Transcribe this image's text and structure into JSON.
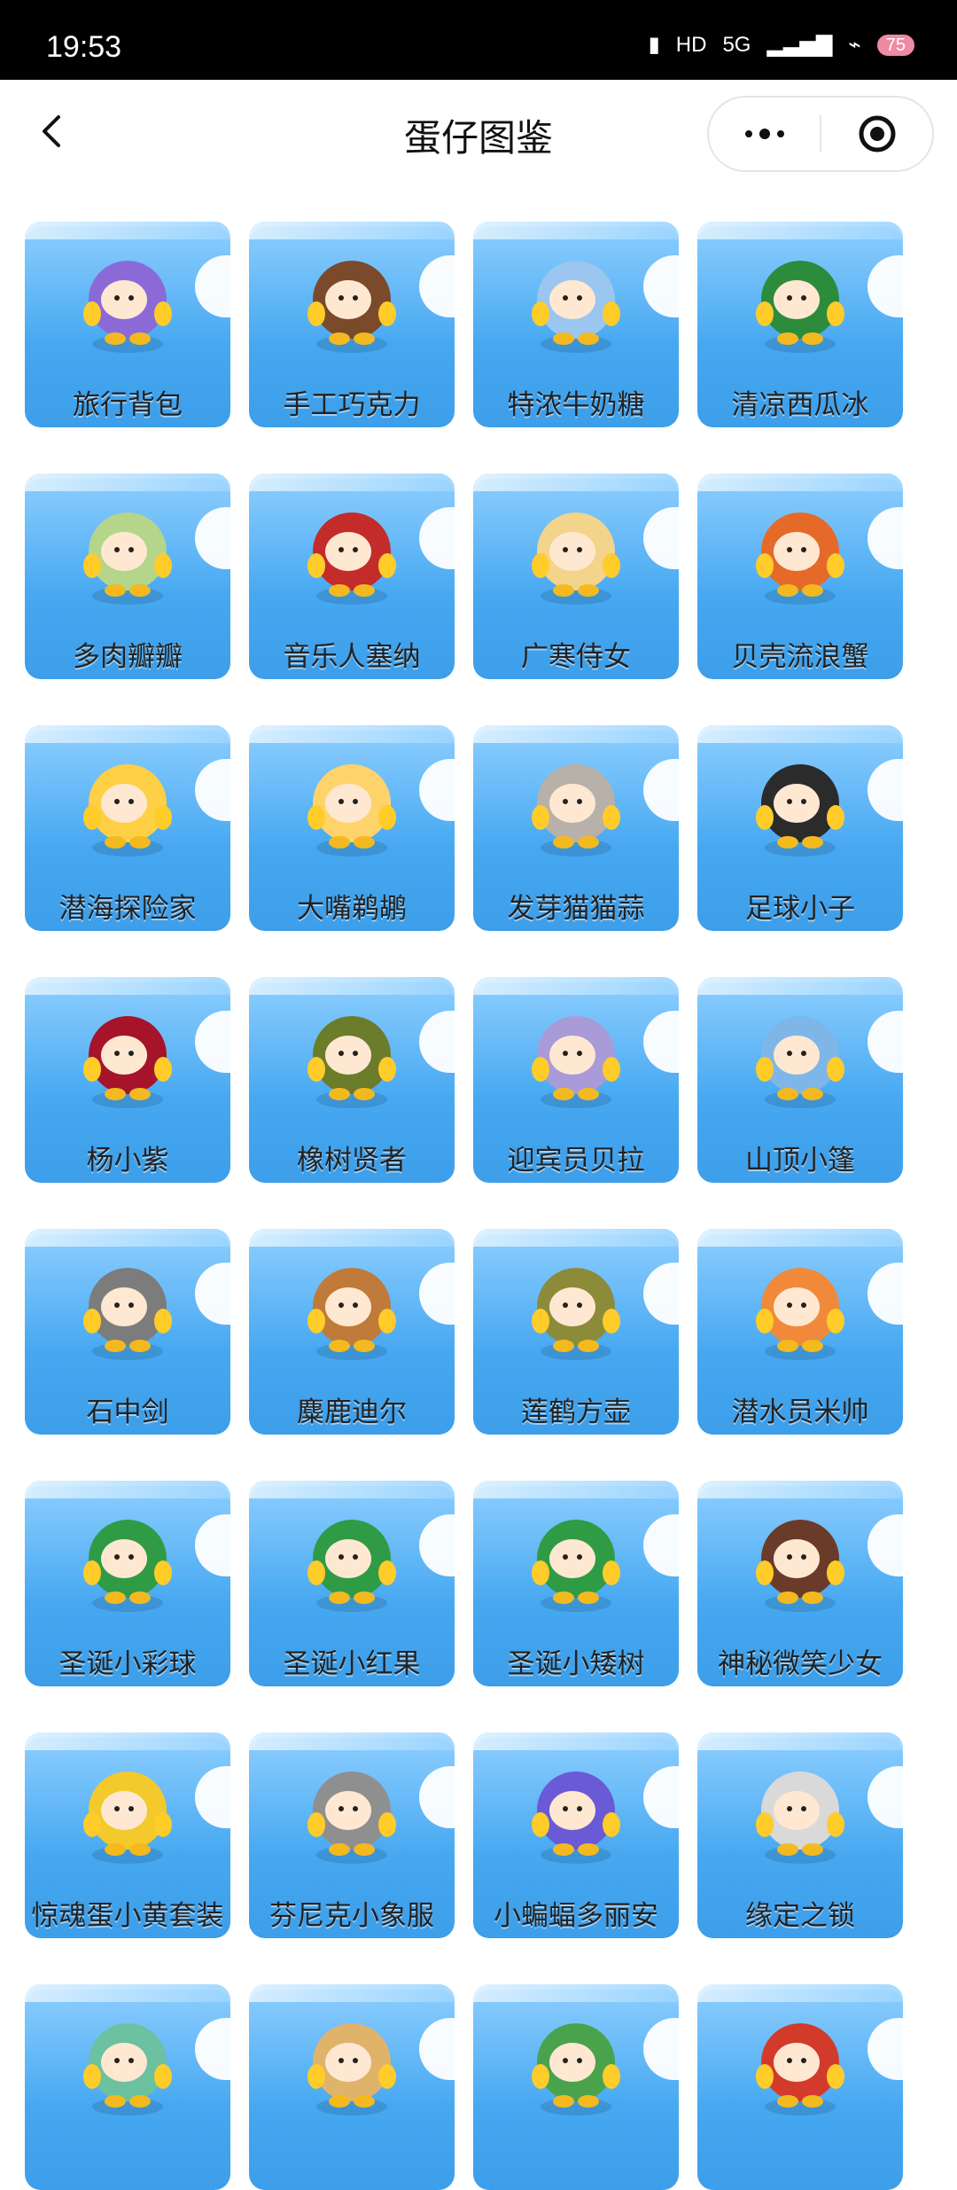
{
  "status": {
    "time": "19:53",
    "signal_label": "5G",
    "battery_level": "75"
  },
  "header": {
    "title": "蛋仔图鉴"
  },
  "grid": {
    "items": [
      {
        "label": "旅行背包",
        "color": "#8b6ad8"
      },
      {
        "label": "手工巧克力",
        "color": "#7a4a2b"
      },
      {
        "label": "特浓牛奶糖",
        "color": "#9ac6f0"
      },
      {
        "label": "清凉西瓜冰",
        "color": "#2d8c3b"
      },
      {
        "label": "多肉瓣瓣",
        "color": "#b5d58a"
      },
      {
        "label": "音乐人塞纳",
        "color": "#c42b2b"
      },
      {
        "label": "广寒侍女",
        "color": "#f3d48b"
      },
      {
        "label": "贝壳流浪蟹",
        "color": "#e56a2a"
      },
      {
        "label": "潜海探险家",
        "color": "#ffcf45"
      },
      {
        "label": "大嘴鹈鹕",
        "color": "#ffd36b"
      },
      {
        "label": "发芽猫猫蒜",
        "color": "#b8b1a9"
      },
      {
        "label": "足球小子",
        "color": "#2b2b2b"
      },
      {
        "label": "杨小紫",
        "color": "#a5142b"
      },
      {
        "label": "橡树贤者",
        "color": "#6b7c2a"
      },
      {
        "label": "迎宾员贝拉",
        "color": "#a99ad8"
      },
      {
        "label": "山顶小篷",
        "color": "#7fb6e8"
      },
      {
        "label": "石中剑",
        "color": "#7c7c7c"
      },
      {
        "label": "麋鹿迪尔",
        "color": "#c07a3a"
      },
      {
        "label": "莲鹤方壶",
        "color": "#8c8b3a"
      },
      {
        "label": "潜水员米帅",
        "color": "#f08a3a"
      },
      {
        "label": "圣诞小彩球",
        "color": "#2f9b45"
      },
      {
        "label": "圣诞小红果",
        "color": "#2f9b45"
      },
      {
        "label": "圣诞小矮树",
        "color": "#2f9b45"
      },
      {
        "label": "神秘微笑少女",
        "color": "#6b3b2a"
      },
      {
        "label": "惊魂蛋小黄套装",
        "color": "#f3c92b"
      },
      {
        "label": "芬尼克小象服",
        "color": "#8f8f8f"
      },
      {
        "label": "小蝙蝠多丽安",
        "color": "#6a5ad6"
      },
      {
        "label": "缘定之锁",
        "color": "#d9d9d9"
      },
      {
        "label": "",
        "color": "#6bc1a0"
      },
      {
        "label": "",
        "color": "#e0b36b"
      },
      {
        "label": "",
        "color": "#4aa34c"
      },
      {
        "label": "",
        "color": "#d23b2b"
      }
    ]
  }
}
